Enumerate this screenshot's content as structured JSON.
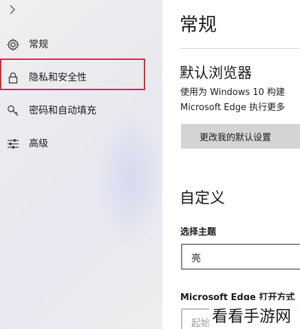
{
  "sidebar": {
    "items": [
      {
        "label": "常规",
        "icon": "gear-icon"
      },
      {
        "label": "隐私和安全性",
        "icon": "lock-icon"
      },
      {
        "label": "密码和自动填充",
        "icon": "key-icon"
      },
      {
        "label": "高级",
        "icon": "sliders-icon"
      }
    ],
    "highlight_color": "#e0262b"
  },
  "main": {
    "title": "常规",
    "default_browser": {
      "heading": "默认浏览器",
      "desc_line1": "使用为 Windows 10 构建",
      "desc_line2": "Microsoft Edge 执行更多",
      "button_label": "更改我的默认设置"
    },
    "customize": {
      "heading": "自定义",
      "theme_label": "选择主题",
      "theme_value": "亮",
      "open_with_label": "Microsoft Edge 打开方式",
      "open_with_value": "起始页"
    }
  },
  "watermark": "看看手游网"
}
